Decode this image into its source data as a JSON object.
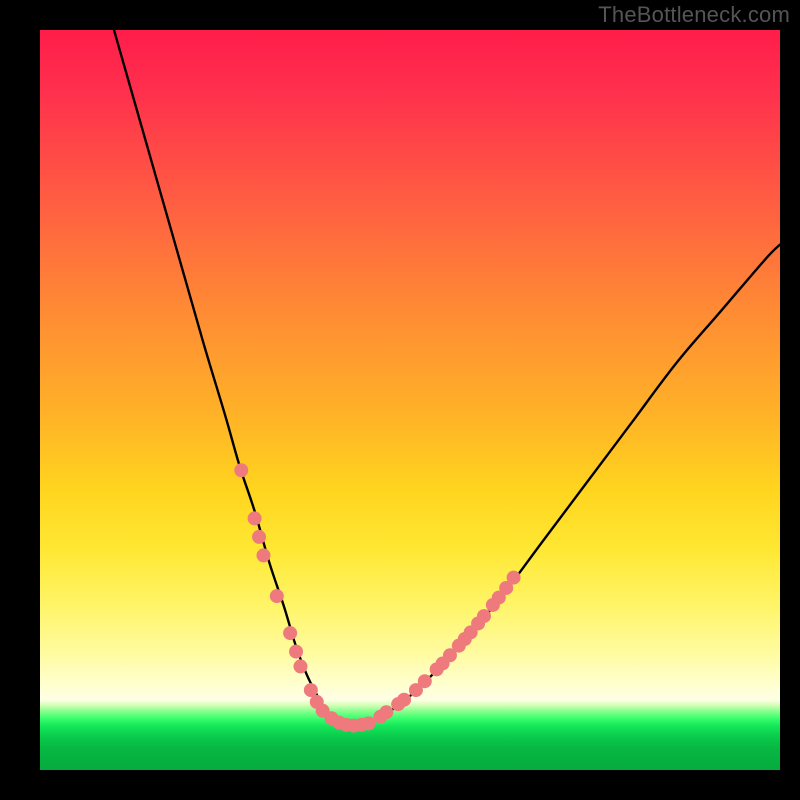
{
  "watermark": "TheBottleneck.com",
  "chart_data": {
    "type": "line",
    "title": "",
    "xlabel": "",
    "ylabel": "",
    "xlim": [
      0,
      100
    ],
    "ylim": [
      0,
      100
    ],
    "grid": false,
    "legend": false,
    "series": [
      {
        "name": "curve",
        "color": "#000000",
        "x": [
          10,
          14,
          18,
          22,
          25,
          27,
          29,
          31,
          33,
          34.5,
          36,
          37.5,
          39,
          40,
          41,
          42.5,
          44,
          46,
          50,
          56,
          62,
          68,
          74,
          80,
          86,
          92,
          98,
          100
        ],
        "y": [
          100,
          86,
          72,
          58,
          48,
          41,
          35,
          28,
          22,
          17,
          13,
          10,
          7.5,
          6.5,
          6,
          6,
          6.3,
          7.2,
          10,
          16,
          23,
          31,
          39,
          47,
          55,
          62,
          69,
          71
        ]
      }
    ],
    "markers": [
      {
        "name": "left-dots",
        "color": "#ef7a7e",
        "radius_px": 7,
        "points": [
          {
            "x": 27.2,
            "y": 40.5
          },
          {
            "x": 29.0,
            "y": 34.0
          },
          {
            "x": 29.6,
            "y": 31.5
          },
          {
            "x": 30.2,
            "y": 29.0
          },
          {
            "x": 32.0,
            "y": 23.5
          },
          {
            "x": 33.8,
            "y": 18.5
          },
          {
            "x": 34.6,
            "y": 16.0
          },
          {
            "x": 35.2,
            "y": 14.0
          },
          {
            "x": 36.6,
            "y": 10.8
          },
          {
            "x": 37.4,
            "y": 9.2
          },
          {
            "x": 38.2,
            "y": 8.0
          },
          {
            "x": 39.4,
            "y": 7.0
          },
          {
            "x": 40.4,
            "y": 6.4
          },
          {
            "x": 41.4,
            "y": 6.1
          },
          {
            "x": 42.4,
            "y": 6.0
          },
          {
            "x": 43.4,
            "y": 6.1
          },
          {
            "x": 44.4,
            "y": 6.3
          }
        ]
      },
      {
        "name": "right-dots",
        "color": "#ef7a7e",
        "radius_px": 7,
        "points": [
          {
            "x": 46.0,
            "y": 7.2
          },
          {
            "x": 46.8,
            "y": 7.8
          },
          {
            "x": 48.4,
            "y": 8.9
          },
          {
            "x": 49.2,
            "y": 9.5
          },
          {
            "x": 50.8,
            "y": 10.8
          },
          {
            "x": 52.0,
            "y": 12.0
          },
          {
            "x": 53.6,
            "y": 13.6
          },
          {
            "x": 54.4,
            "y": 14.4
          },
          {
            "x": 55.4,
            "y": 15.5
          },
          {
            "x": 56.6,
            "y": 16.8
          },
          {
            "x": 57.4,
            "y": 17.7
          },
          {
            "x": 58.2,
            "y": 18.6
          },
          {
            "x": 59.2,
            "y": 19.8
          },
          {
            "x": 60.0,
            "y": 20.8
          },
          {
            "x": 61.2,
            "y": 22.3
          },
          {
            "x": 62.0,
            "y": 23.3
          },
          {
            "x": 63.0,
            "y": 24.6
          },
          {
            "x": 64.0,
            "y": 26.0
          }
        ]
      }
    ]
  }
}
